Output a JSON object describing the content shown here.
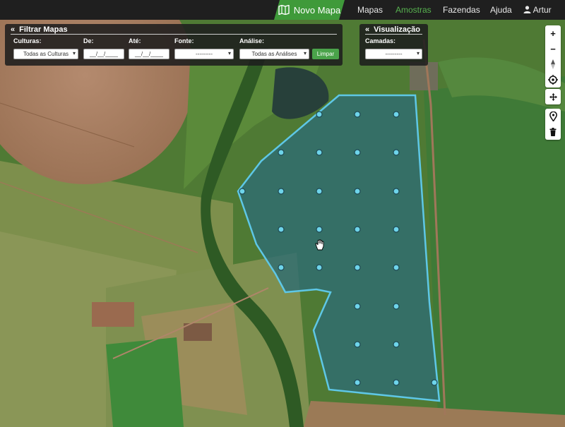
{
  "nav": {
    "new_map_label": "Novo Mapa",
    "links": [
      "Mapas",
      "Amostras",
      "Fazendas",
      "Ajuda"
    ],
    "active_link": "Amostras",
    "user": "Artur",
    "accent_color": "#3f9a3a",
    "active_color": "#57b14f"
  },
  "filter_panel": {
    "title": "Filtrar Mapas",
    "culturas_label": "Culturas:",
    "culturas_value": "Todas as Culturas",
    "de_label": "De:",
    "de_value": "__/__/____",
    "ate_label": "Até:",
    "ate_value": "__/__/____",
    "fonte_label": "Fonte:",
    "fonte_value": "---------",
    "analise_label": "Análise:",
    "analise_value": "Todas as Análises",
    "limpar_label": "Limpar"
  },
  "view_panel": {
    "title": "Visualização",
    "camadas_label": "Camadas:",
    "camadas_value": "---------"
  },
  "map_tools": [
    "zoom-in",
    "zoom-out",
    "reset-north",
    "locate",
    "move",
    "marker",
    "delete"
  ],
  "field": {
    "fill_color": "#2f6c72",
    "border_color": "#5ec7e6",
    "sample_point_count": 27
  }
}
